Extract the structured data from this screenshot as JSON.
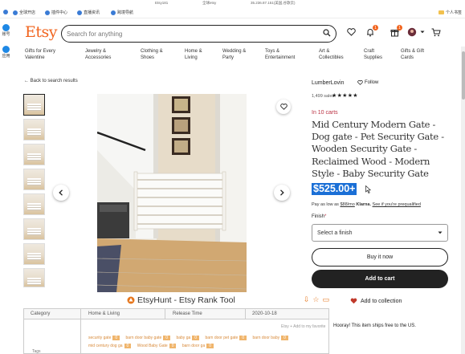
{
  "browser": {
    "top_items": [
      "Etsy181",
      "全球etsy",
      "35.236.87.151(美国,谷歌云)"
    ],
    "bookmarks": [
      "全球开店",
      "插件中心",
      "直播资讯",
      "跨境导航"
    ],
    "bookmarks_right": "个人书签",
    "left_rail": [
      "账号",
      "应用"
    ]
  },
  "header": {
    "logo": "Etsy",
    "search_placeholder": "Search for anything",
    "notification_count": "1",
    "cart_count": "1"
  },
  "categories": [
    "Gifts for Every Valentine",
    "Jewelry & Accessories",
    "Clothing & Shoes",
    "Home & Living",
    "Wedding & Party",
    "Toys & Entertainment",
    "Art & Collectibles",
    "Craft Supplies",
    "Gifts & Gift Cards"
  ],
  "back_link": "Back to search results",
  "listing": {
    "shop_name": "LumberLovin",
    "follow_label": "Follow",
    "sales": "1,499 sales",
    "stars": "★★★★★",
    "rating": 5,
    "in_carts": "In 10 carts",
    "title": "Mid Century Modern Gate - Dog gate - Pet Security Gate - Wooden Security Gate - Reclaimed Wood - Modern Style - Baby Security Gate",
    "price": "$525.00+",
    "pay_prefix": "Pay as low as ",
    "pay_amount": "$88/mo",
    "pay_provider": "Klarna.",
    "pay_link": "See if you're prequalified",
    "finish_label": "Finish",
    "finish_required_mark": "*",
    "finish_select": "Select a finish",
    "buy_now": "Buy it now",
    "add_to_cart": "Add to cart",
    "add_to_collection": "Add to collection",
    "hooray": "Hooray! This item ships free to the US."
  },
  "etsyhunt": {
    "title": "EtsyHunt - Etsy Rank Tool",
    "row": {
      "category_label": "Category",
      "category_value": "Home & Living",
      "release_label": "Release Time",
      "release_value": "2020-10-18"
    },
    "side_hint": "Etsy  + Add to my favorite",
    "tags": [
      {
        "name": "security gate",
        "count": "0"
      },
      {
        "name": "barn door baby gate",
        "count": "0"
      },
      {
        "name": "baby ga",
        "count": "0"
      },
      {
        "name": "barn door pet gate",
        "count": "0"
      },
      {
        "name": "barn door baby",
        "count": "0"
      },
      {
        "name": "mid century dog ga",
        "count": "0"
      },
      {
        "name": "Wood Baby Gate",
        "count": "0"
      },
      {
        "name": "barn door ga",
        "count": "0"
      }
    ],
    "left_label": "Tags"
  },
  "colors": {
    "etsy_orange": "#f1641e",
    "price_highlight": "#1a6fd6",
    "in_carts_red": "#b34444",
    "etsyhunt_orange": "#e6761c"
  }
}
